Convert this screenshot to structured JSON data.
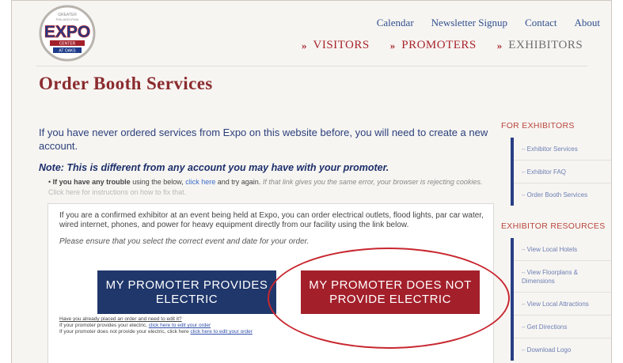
{
  "header": {
    "logo_text": [
      "GREATER",
      "PHILADELPHIA",
      "EXPO",
      "CENTER",
      "AT OAKS"
    ],
    "top_links": [
      "Calendar",
      "Newsletter Signup",
      "Contact",
      "About"
    ],
    "main_nav": [
      "VISITORS",
      "PROMOTERS",
      "EXHIBITORS"
    ]
  },
  "page": {
    "title": "Order Booth Services",
    "intro": "If you have never ordered services from Expo on this website before, you will need to create a new account.",
    "note": "Note: This is different from any account you may have with your promoter.",
    "bullet": {
      "bold": "If you have any trouble",
      "t1": " using the below, ",
      "link": "click here",
      "t2": " and try again. ",
      "italic": "If that link gives you the same error, your browser is rejecting cookies.",
      "light": " Click here for instructions on how to fix that."
    }
  },
  "panel": {
    "text": "If you are a confirmed exhibitor at an event being held at Expo, you can order electrical outlets, flood lights, par car water, wired internet, phones, and power for heavy equipment directly from our facility using the link below.",
    "ensure": "Please ensure that you select the correct event and date for your order.",
    "btn_provides": "MY PROMOTER PROVIDES ELECTRIC",
    "btn_not_provide": "MY PROMOTER DOES NOT PROVIDE ELECTRIC",
    "small1": "Have you already placed an order and need to edit it?",
    "small2_text": "If your promoter provides your electric, ",
    "small2_link": "click here to edit your order",
    "small3_text": "If your promoter does not provide your electric, click here ",
    "small3_link": "click here to edit your order"
  },
  "sidebar": {
    "for_exhibitors": "FOR EXHIBITORS",
    "exhibitor_links": [
      "Exhibitor Services",
      "Exhibitor FAQ",
      "Order Booth Services"
    ],
    "resources": "EXHIBITOR RESOURCES",
    "resource_links": [
      "View Local Hotels",
      "View Floorplans & Dimensions",
      "View Local Attractions",
      "Get Directions",
      "Download Logo"
    ]
  },
  "colors": {
    "brand_red": "#a3202b",
    "brand_navy": "#20376b",
    "highlight_circle": "#c8272f"
  }
}
